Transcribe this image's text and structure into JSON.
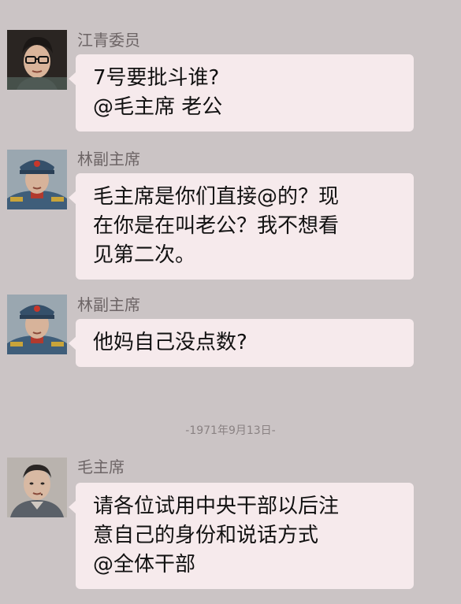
{
  "messages": [
    {
      "sender": "江青委员",
      "avatar_icon": "woman-with-glasses-portrait",
      "lines": [
        "7号要批斗谁?",
        "@毛主席 老公"
      ]
    },
    {
      "sender": "林副主席",
      "avatar_icon": "military-officer-portrait",
      "lines": [
        "毛主席是你们直接@的？现",
        "在你是在叫老公？我不想看",
        "见第二次。"
      ]
    },
    {
      "sender": "林副主席",
      "avatar_icon": "military-officer-portrait",
      "lines": [
        "他妈自己没点数?"
      ]
    },
    {
      "sender": "毛主席",
      "avatar_icon": "chairman-portrait",
      "lines": [
        "请各位试用中央干部以后注",
        "意自己的身份和说话方式",
        "@全体干部"
      ]
    }
  ],
  "timestamp": "-1971年9月13日-",
  "colors": {
    "background": "#cbc4c5",
    "bubble": "#f6eaec",
    "sender_text": "#6d6566",
    "timestamp_text": "#8a8283"
  }
}
